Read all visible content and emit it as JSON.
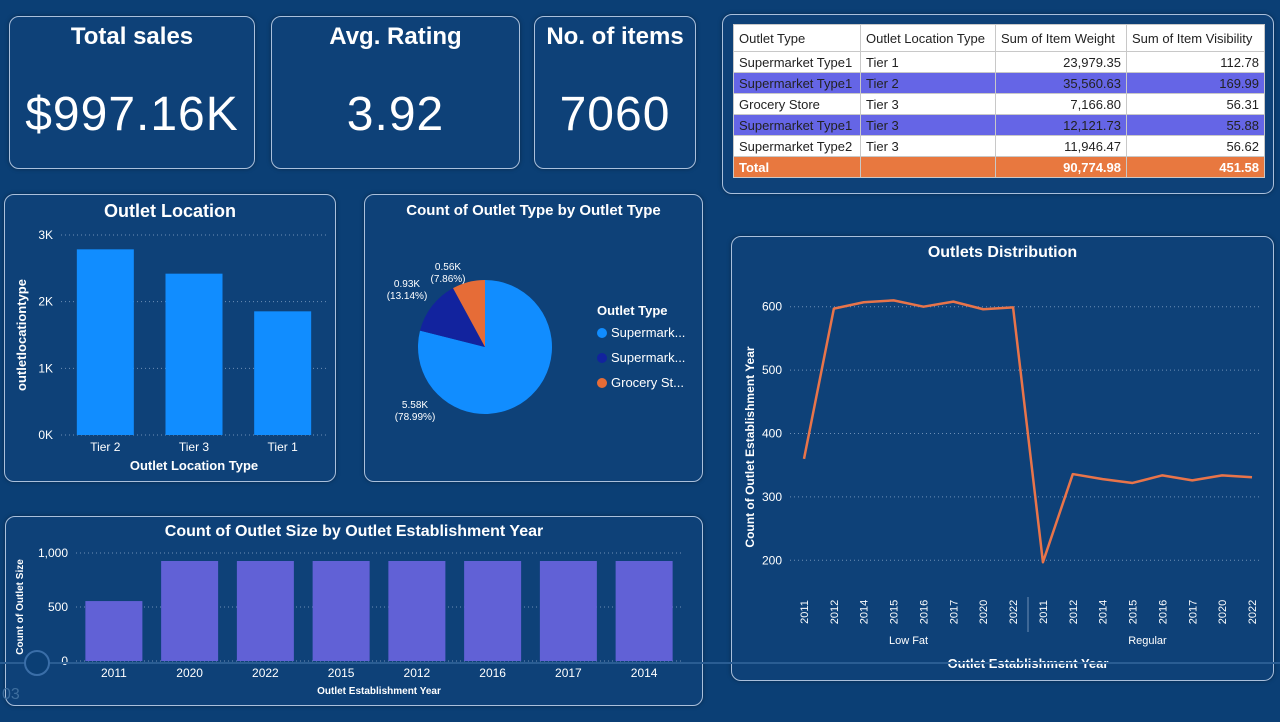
{
  "kpis": [
    {
      "title": "Total sales",
      "value": "$997.16K"
    },
    {
      "title": "Avg. Rating",
      "value": "3.92"
    },
    {
      "title": "No. of items",
      "value": "7060"
    }
  ],
  "table": {
    "headers": [
      "Outlet Type",
      "Outlet Location Type",
      "Sum of Item Weight",
      "Sum of Item Visibility"
    ],
    "rows": [
      [
        "Supermarket Type1",
        "Tier 1",
        "23,979.35",
        "112.78"
      ],
      [
        "Supermarket Type1",
        "Tier 2",
        "35,560.63",
        "169.99"
      ],
      [
        "Grocery Store",
        "Tier 3",
        "7,166.80",
        "56.31"
      ],
      [
        "Supermarket Type1",
        "Tier 3",
        "12,121.73",
        "55.88"
      ],
      [
        "Supermarket Type2",
        "Tier 3",
        "11,946.47",
        "56.62"
      ]
    ],
    "total": [
      "Total",
      "",
      "90,774.98",
      "451.58"
    ],
    "colors": {
      "highlight": "#6565e6",
      "total": "#e8783f"
    }
  },
  "chart_data": [
    {
      "type": "bar",
      "title": "Outlet Location",
      "xlabel": "Outlet Location Type",
      "ylabel": "outletlocationtype",
      "categories": [
        "Tier 2",
        "Tier 3",
        "Tier 1"
      ],
      "values": [
        2785,
        2420,
        1855
      ],
      "ylim": [
        0,
        3000
      ],
      "yticks": [
        0,
        1000,
        2000,
        3000
      ],
      "yticklabels": [
        "0K",
        "1K",
        "2K",
        "3K"
      ],
      "grid": true,
      "color": "#118dff"
    },
    {
      "type": "pie",
      "title": "Count of Outlet Type by Outlet Type",
      "legend_title": "Outlet Type",
      "legend_position": "right",
      "slices": [
        {
          "name": "Supermark...",
          "value": 5.58,
          "label": "5.58K",
          "pct": "(78.99%)",
          "color": "#118dff"
        },
        {
          "name": "Supermark...",
          "value": 0.93,
          "label": "0.93K",
          "pct": "(13.14%)",
          "color": "#12239e"
        },
        {
          "name": "Grocery St...",
          "value": 0.56,
          "label": "0.56K",
          "pct": "(7.86%)",
          "color": "#e66c37"
        }
      ]
    },
    {
      "type": "bar",
      "title": "Count of Outlet Size by Outlet Establishment Year",
      "xlabel": "Outlet Establishment Year",
      "ylabel": "Count of Outlet Size",
      "categories": [
        "2011",
        "2020",
        "2022",
        "2015",
        "2012",
        "2016",
        "2017",
        "2014"
      ],
      "values": [
        555,
        926,
        926,
        926,
        926,
        926,
        926,
        926
      ],
      "ylim": [
        0,
        1000
      ],
      "yticks": [
        0,
        500,
        1000
      ],
      "yticklabels": [
        "0",
        "500",
        "1,000"
      ],
      "grid": true,
      "color": "#6161d6"
    },
    {
      "type": "line",
      "title": "Outlets Distribution",
      "xlabel": "Outlet Establishment Year",
      "ylabel": "Count of Outlet Establishment Year",
      "groups": [
        "Low Fat",
        "Regular"
      ],
      "x": [
        "2011",
        "2012",
        "2014",
        "2015",
        "2016",
        "2017",
        "2020",
        "2022",
        "2011",
        "2012",
        "2014",
        "2015",
        "2016",
        "2017",
        "2020",
        "2022"
      ],
      "values": [
        360,
        597,
        607,
        610,
        600,
        608,
        596,
        599,
        197,
        336,
        328,
        322,
        334,
        326,
        334,
        331
      ],
      "ylim": [
        150,
        650
      ],
      "yticks": [
        200,
        300,
        400,
        500,
        600
      ],
      "grid": true,
      "color": "#e8744a"
    }
  ],
  "page_number": "03"
}
